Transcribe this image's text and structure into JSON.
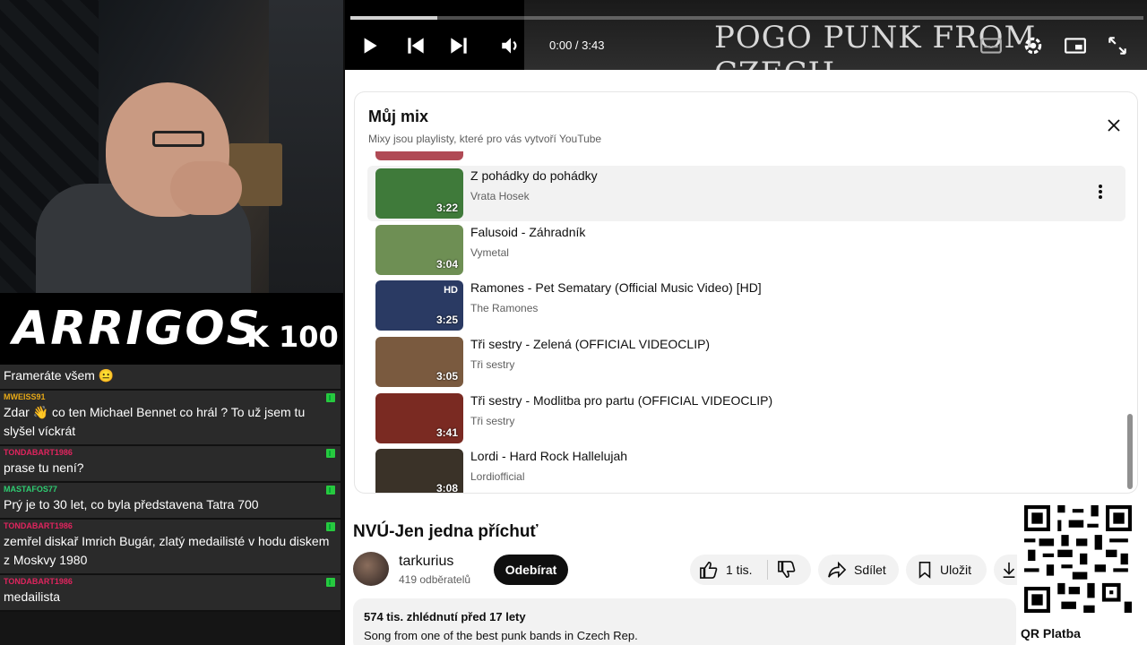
{
  "stream": {
    "logo": "ARRIGOS",
    "rank": "K 100",
    "chat": [
      {
        "nick": "",
        "nick_color": "#ffffff",
        "text": "Frameráte všem 😐"
      },
      {
        "nick": "MWEISS91",
        "nick_color": "#e6a817",
        "text": "Zdar 👋 co ten Michael Bennet co hrál ? To už jsem tu slyšel víckrát"
      },
      {
        "nick": "TONDABART1986",
        "nick_color": "#e0245e",
        "text": "prase tu není?"
      },
      {
        "nick": "MASTAFOS77",
        "nick_color": "#2ecc71",
        "text": "Prý je to 30 let, co byla představena Tatra 700"
      },
      {
        "nick": "TONDABART1986",
        "nick_color": "#e0245e",
        "text": "zemřel diskař Imrich Bugár, zlatý medailisté v hodu diskem z Moskvy 1980"
      },
      {
        "nick": "TONDABART1986",
        "nick_color": "#e0245e",
        "text": "medailista"
      }
    ]
  },
  "player": {
    "frame_text": "POGO PUNK FROM CZECH",
    "time": "0:00 / 3:43",
    "progress": 0.11
  },
  "mix": {
    "title": "Můj mix",
    "subtitle": "Mixy jsou playlisty, které pro vás vytvoří YouTube",
    "items": [
      {
        "title": "Z pohádky do pohádky",
        "channel": "Vrata Hosek",
        "duration": "3:22",
        "hd": "",
        "color": "#3f7a3a"
      },
      {
        "title": "Falusoid - Záhradník",
        "channel": "Vymetal",
        "duration": "3:04",
        "hd": "",
        "color": "#6e8f54"
      },
      {
        "title": "Ramones - Pet Sematary (Official Music Video) [HD]",
        "channel": "The Ramones",
        "duration": "3:25",
        "hd": "HD",
        "color": "#2a3a63"
      },
      {
        "title": "Tři sestry - Zelená (OFFICIAL VIDEOCLIP)",
        "channel": "Tři sestry",
        "duration": "3:05",
        "hd": "",
        "color": "#7a5a3f"
      },
      {
        "title": "Tři sestry - Modlitba pro partu (OFFICIAL VIDEOCLIP)",
        "channel": "Tři sestry",
        "duration": "3:41",
        "hd": "",
        "color": "#7a2a22"
      },
      {
        "title": "Lordi - Hard Rock Hallelujah",
        "channel": "Lordiofficial",
        "duration": "3:08",
        "hd": "",
        "color": "#3a3228"
      }
    ]
  },
  "video": {
    "title": "NVÚ-Jen jedna příchuť",
    "channel": "tarkurius",
    "subscribers": "419 odběratelů",
    "subscribe": "Odebírat",
    "likes": "1 tis.",
    "share": "Sdílet",
    "save": "Uložit",
    "views_date": "574 tis. zhlédnutí  před 17 lety",
    "description": "Song from one of the best punk bands in Czech Rep."
  },
  "qr": {
    "label": "QR Platba"
  }
}
